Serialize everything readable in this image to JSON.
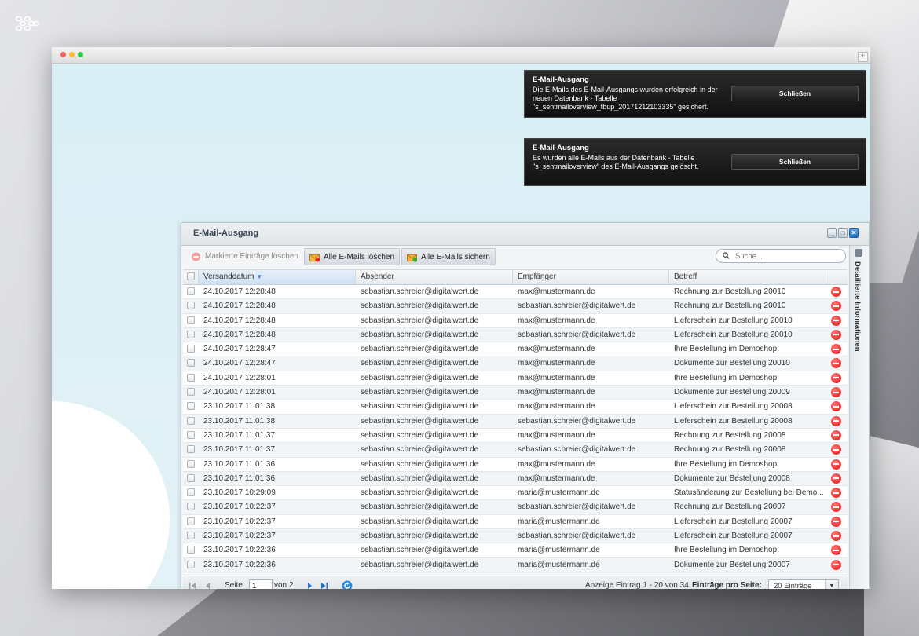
{
  "notifications": [
    {
      "title": "E-Mail-Ausgang",
      "message": "Die E-Mails des E-Mail-Ausgangs wurden erfolgreich in der neuen Datenbank - Tabelle \"s_sentmailoverview_tbup_20171212103335\" gesichert.",
      "button": "Schließen"
    },
    {
      "title": "E-Mail-Ausgang",
      "message": "Es wurden alle E-Mails aus der Datenbank - Tabelle \"s_sentmailoverview\" des E-Mail-Ausgangs gelöscht.",
      "button": "Schließen"
    }
  ],
  "panel": {
    "title": "E-Mail-Ausgang",
    "toolbar": {
      "delete_selected": "Markierte Einträge löschen",
      "delete_all": "Alle E-Mails löschen",
      "backup_all": "Alle E-Mails sichern",
      "search_placeholder": "Suche..."
    },
    "columns": [
      "Versanddatum",
      "Absender",
      "Empfänger",
      "Betreff"
    ],
    "rows": [
      [
        "24.10.2017 12:28:48",
        "sebastian.schreier@digitalwert.de",
        "max@mustermann.de",
        "Rechnung zur Bestellung 20010"
      ],
      [
        "24.10.2017 12:28:48",
        "sebastian.schreier@digitalwert.de",
        "sebastian.schreier@digitalwert.de",
        "Rechnung zur Bestellung 20010"
      ],
      [
        "24.10.2017 12:28:48",
        "sebastian.schreier@digitalwert.de",
        "max@mustermann.de",
        "Lieferschein zur Bestellung 20010"
      ],
      [
        "24.10.2017 12:28:48",
        "sebastian.schreier@digitalwert.de",
        "sebastian.schreier@digitalwert.de",
        "Lieferschein zur Bestellung 20010"
      ],
      [
        "24.10.2017 12:28:47",
        "sebastian.schreier@digitalwert.de",
        "max@mustermann.de",
        "Ihre Bestellung im Demoshop"
      ],
      [
        "24.10.2017 12:28:47",
        "sebastian.schreier@digitalwert.de",
        "max@mustermann.de",
        "Dokumente zur Bestellung 20010"
      ],
      [
        "24.10.2017 12:28:01",
        "sebastian.schreier@digitalwert.de",
        "max@mustermann.de",
        "Ihre Bestellung im Demoshop"
      ],
      [
        "24.10.2017 12:28:01",
        "sebastian.schreier@digitalwert.de",
        "max@mustermann.de",
        "Dokumente zur Bestellung 20009"
      ],
      [
        "23.10.2017 11:01:38",
        "sebastian.schreier@digitalwert.de",
        "max@mustermann.de",
        "Lieferschein zur Bestellung 20008"
      ],
      [
        "23.10.2017 11:01:38",
        "sebastian.schreier@digitalwert.de",
        "sebastian.schreier@digitalwert.de",
        "Lieferschein zur Bestellung 20008"
      ],
      [
        "23.10.2017 11:01:37",
        "sebastian.schreier@digitalwert.de",
        "max@mustermann.de",
        "Rechnung zur Bestellung 20008"
      ],
      [
        "23.10.2017 11:01:37",
        "sebastian.schreier@digitalwert.de",
        "sebastian.schreier@digitalwert.de",
        "Rechnung zur Bestellung 20008"
      ],
      [
        "23.10.2017 11:01:36",
        "sebastian.schreier@digitalwert.de",
        "max@mustermann.de",
        "Ihre Bestellung im Demoshop"
      ],
      [
        "23.10.2017 11:01:36",
        "sebastian.schreier@digitalwert.de",
        "max@mustermann.de",
        "Dokumente zur Bestellung 20008"
      ],
      [
        "23.10.2017 10:29:09",
        "sebastian.schreier@digitalwert.de",
        "maria@mustermann.de",
        "Statusänderung zur Bestellung bei Demo..."
      ],
      [
        "23.10.2017 10:22:37",
        "sebastian.schreier@digitalwert.de",
        "sebastian.schreier@digitalwert.de",
        "Rechnung zur Bestellung 20007"
      ],
      [
        "23.10.2017 10:22:37",
        "sebastian.schreier@digitalwert.de",
        "maria@mustermann.de",
        "Lieferschein zur Bestellung 20007"
      ],
      [
        "23.10.2017 10:22:37",
        "sebastian.schreier@digitalwert.de",
        "sebastian.schreier@digitalwert.de",
        "Lieferschein zur Bestellung 20007"
      ],
      [
        "23.10.2017 10:22:36",
        "sebastian.schreier@digitalwert.de",
        "maria@mustermann.de",
        "Ihre Bestellung im Demoshop"
      ],
      [
        "23.10.2017 10:22:36",
        "sebastian.schreier@digitalwert.de",
        "maria@mustermann.de",
        "Dokumente zur Bestellung 20007"
      ]
    ],
    "pager": {
      "page_label": "Seite",
      "page_value": "1",
      "of_label": "von 2",
      "display_info": "Anzeige Eintrag 1 - 20 von 34",
      "per_page_label": "Einträge pro Seite:",
      "per_page_value": "20 Einträge"
    },
    "sidebar_label": "Detaillierte Informationen"
  },
  "colors": {
    "accent_blue": "#2271c8",
    "delete_red": "#dd1111",
    "notification_bg": "#1a1a1a"
  },
  "icons": [
    "app-logo-icon",
    "minimize-icon",
    "maximize-icon",
    "close-icon",
    "search-icon",
    "delete-icon",
    "mail-delete-icon",
    "mail-save-icon",
    "first-page-icon",
    "prev-page-icon",
    "next-page-icon",
    "last-page-icon",
    "refresh-icon",
    "sort-desc-icon",
    "chevron-down-icon",
    "row-delete-icon"
  ]
}
